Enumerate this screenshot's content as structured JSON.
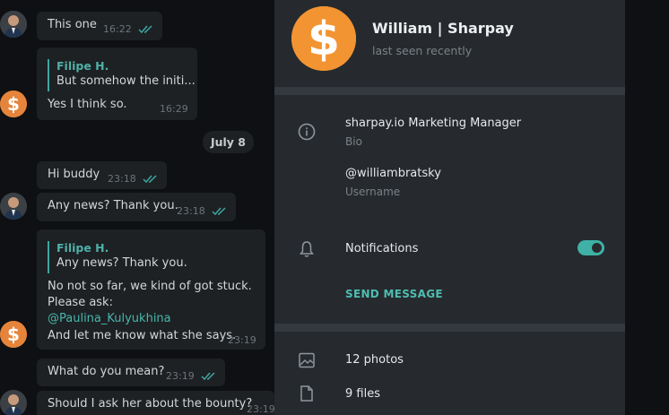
{
  "chat": {
    "messages": [
      {
        "text": "This one",
        "time": "16:22",
        "read": true
      },
      {
        "reply_name": "Filipe H.",
        "reply_text": "But somehow the initi...",
        "text": "Yes I think so.",
        "time": "16:29"
      },
      {
        "text": "Hi buddy",
        "time": "23:18",
        "read": true
      },
      {
        "text": "Any news? Thank you.",
        "time": "23:18",
        "read": true
      },
      {
        "reply_name": "Filipe H.",
        "reply_text": "Any news? Thank you.",
        "lines": [
          "No not so far, we kind of got stuck.",
          "Please ask:",
          "@Paulina_Kulyukhina",
          "And let me know what she says."
        ],
        "time": "23:19"
      },
      {
        "text": "What do you mean?",
        "time": "23:19",
        "read": true
      },
      {
        "text": "Should I ask her about the bounty?",
        "time": "23:19"
      }
    ],
    "date_divider": "July 8"
  },
  "profile": {
    "name": "William | Sharpay",
    "status": "last seen recently",
    "bio": "sharpay.io Marketing Manager",
    "bio_label": "Bio",
    "username": "@williambratsky",
    "username_label": "Username",
    "notifications_label": "Notifications",
    "notifications_on": true,
    "send_message": "SEND MESSAGE",
    "photos": "12 photos",
    "files": "9 files"
  },
  "colors": {
    "accent": "#4fbdb2",
    "panel": "#262a2e",
    "background": "#0e1013",
    "bubble": "#1d2124"
  },
  "icons": [
    "info-icon",
    "bell-icon",
    "image-icon",
    "file-icon",
    "double-check-icon",
    "dollar-logo-icon"
  ]
}
